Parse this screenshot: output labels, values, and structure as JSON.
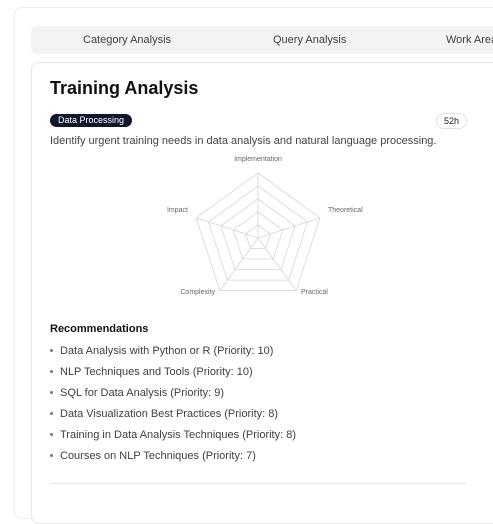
{
  "tabs": [
    {
      "label": "Category Analysis"
    },
    {
      "label": "Query Analysis"
    },
    {
      "label": "Work Area"
    }
  ],
  "card": {
    "title": "Training Analysis",
    "tag": "Data Processing",
    "duration": "52h",
    "description": "Identify urgent training needs in data analysis and natural language processing."
  },
  "radar": {
    "axes": [
      "Implementation",
      "Theoretical",
      "Practical",
      "Complexity",
      "Impact"
    ],
    "grid_levels": 5,
    "grid_color": "#d6d6d6"
  },
  "recommendations": {
    "heading": "Recommendations",
    "items": [
      "Data Analysis with Python or R (Priority: 10)",
      "NLP Techniques and Tools (Priority: 10)",
      "SQL for Data Analysis (Priority: 9)",
      "Data Visualization Best Practices (Priority: 8)",
      "Training in Data Analysis Techniques (Priority: 8)",
      "Courses on NLP Techniques (Priority: 7)"
    ]
  }
}
